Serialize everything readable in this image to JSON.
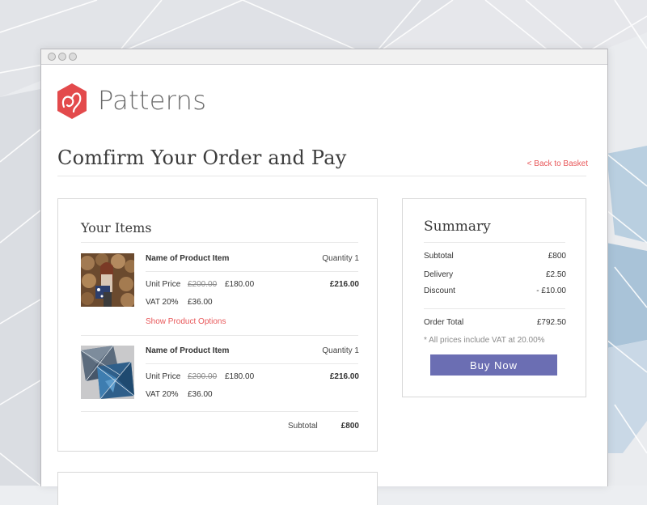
{
  "brand": {
    "name": "Patterns",
    "accent": "#e34a4c"
  },
  "page": {
    "title": "Comfirm Your Order and Pay",
    "back_link": "< Back to Basket"
  },
  "items_section": {
    "title": "Your Items",
    "items": [
      {
        "name": "Name of Product Item",
        "quantity": "Quantity 1",
        "unit_price_label": "Unit Price",
        "old_price": "£200.00",
        "price": "£180.00",
        "total": "£216.00",
        "vat_label": "VAT 20%",
        "vat_value": "£36.00",
        "options_link": "Show Product Options",
        "image": "woman-with-bag-photo"
      },
      {
        "name": "Name of Product Item",
        "quantity": "Quantity 1",
        "unit_price_label": "Unit Price",
        "old_price": "£200.00",
        "price": "£180.00",
        "total": "£216.00",
        "vat_label": "VAT 20%",
        "vat_value": "£36.00",
        "image": "cushions-photo"
      }
    ],
    "subtotal_label": "Subtotal",
    "subtotal_value": "£800"
  },
  "summary": {
    "title": "Summary",
    "rows": [
      {
        "label": "Subtotal",
        "value": "£800"
      },
      {
        "label": "Delivery",
        "value": "£2.50"
      },
      {
        "label": "Discount",
        "value": "- £10.00"
      }
    ],
    "order_total_label": "Order Total",
    "order_total_value": "£792.50",
    "vat_note": "* All prices include VAT at 20.00%",
    "buy_button": "Buy Now",
    "button_color": "#6b6eb3"
  }
}
